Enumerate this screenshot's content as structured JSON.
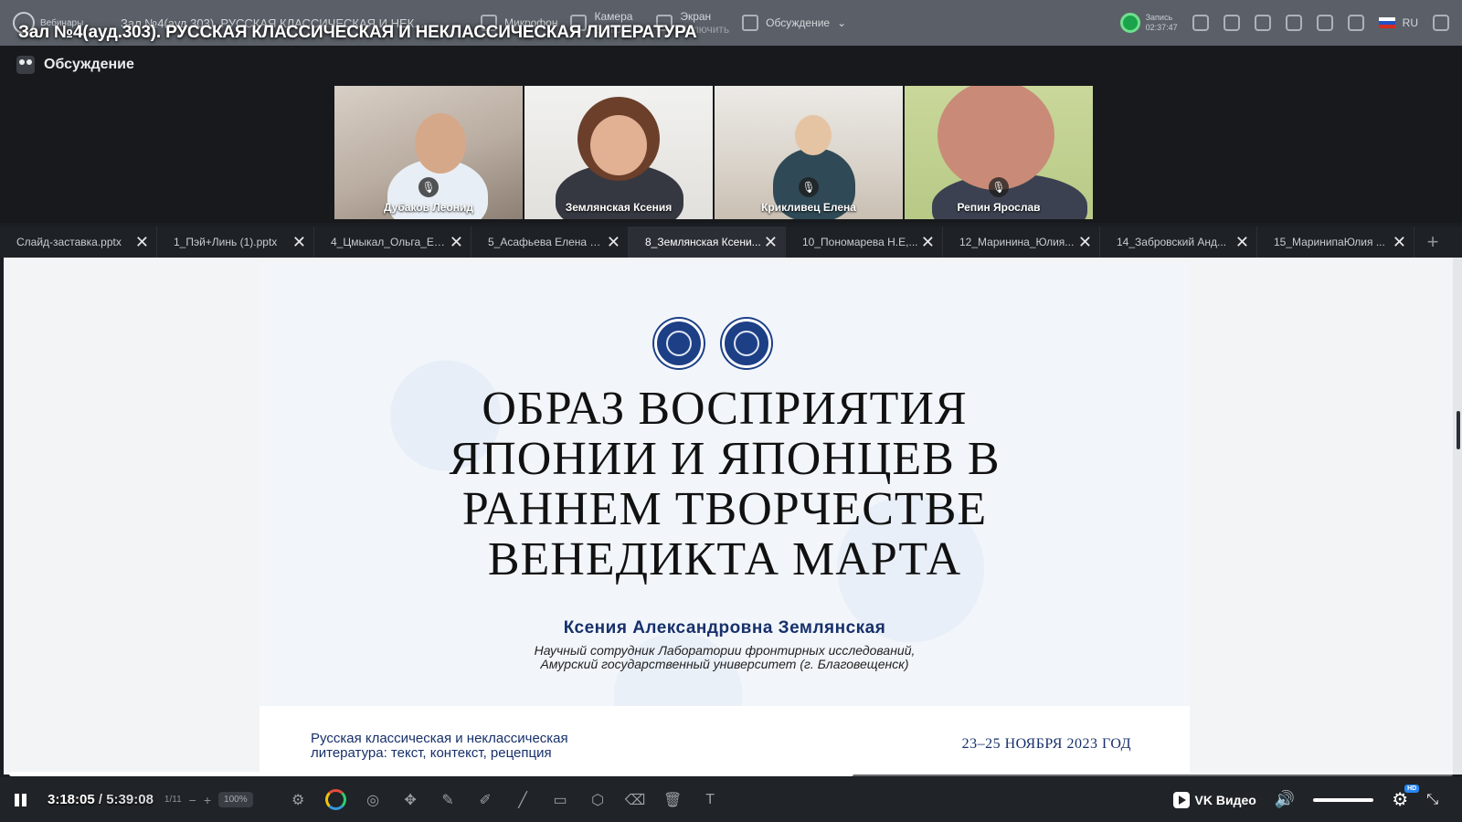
{
  "overlay_title": "Зал №4(ауд.303). РУССКАЯ КЛАССИЧЕСКАЯ И НЕКЛАССИЧЕСКАЯ ЛИТЕРАТУРА",
  "topbar": {
    "brand": "Вебинары",
    "room_title": "Зал №4(ауд.303). РУССКАЯ КЛАССИЧЕСКАЯ И НЕК...",
    "microphone": "Микрофон",
    "camera": "Камера",
    "camera_sub": "Включить",
    "screen": "Экран",
    "screen_sub": "Включить",
    "layout": "Обсуждение",
    "recording_label": "Запись",
    "recording_time": "02:37:47",
    "language": "RU"
  },
  "discussion_label": "Обсуждение",
  "participants": [
    {
      "name": "Дубаков Леонид"
    },
    {
      "name": "Землянская Ксения"
    },
    {
      "name": "Крикливец Елена"
    },
    {
      "name": "Репин Ярослав"
    }
  ],
  "file_tabs": [
    "Слайд-заставка.pptx",
    "1_Пэй+Линь (1).pptx",
    "4_Цмыкал_Ольга_Ев...",
    "5_Асафьева Елена В...",
    "8_Землянская Ксени...",
    "10_Пономарева Н.Е,...",
    "12_Маринина_Юлия...",
    "14_Забровский Анд...",
    "15_МаринипаЮлия ..."
  ],
  "active_tab_index": 4,
  "slide": {
    "title_lines": [
      "ОБРАЗ ВОСПРИЯТИЯ",
      "ЯПОНИИ И ЯПОНЦЕВ В",
      "РАННЕМ ТВОРЧЕСТВЕ",
      "ВЕНЕДИКТА МАРТА"
    ],
    "author": "Ксения Александровна Землянская",
    "affiliation_line1": "Научный сотрудник Лаборатории фронтирных исследований,",
    "affiliation_line2": "Амурский государственный университет (г. Благовещенск)",
    "conference_line1": "Русская классическая и неклассическая",
    "conference_line2": "литература: текст, контекст, рецепция",
    "dates": "23–25 НОЯБРЯ 2023 ГОД"
  },
  "player": {
    "current_time": "3:18:05",
    "separator": " / ",
    "total_time": "5:39:08",
    "progress": 0.585,
    "page": "1/11",
    "zoom": "100%",
    "brand": "VK Видео",
    "quality_badge": "HD"
  },
  "colors": {
    "slide_text": "#111111",
    "slide_accent": "#17306b",
    "record_green": "#1aa34a"
  }
}
